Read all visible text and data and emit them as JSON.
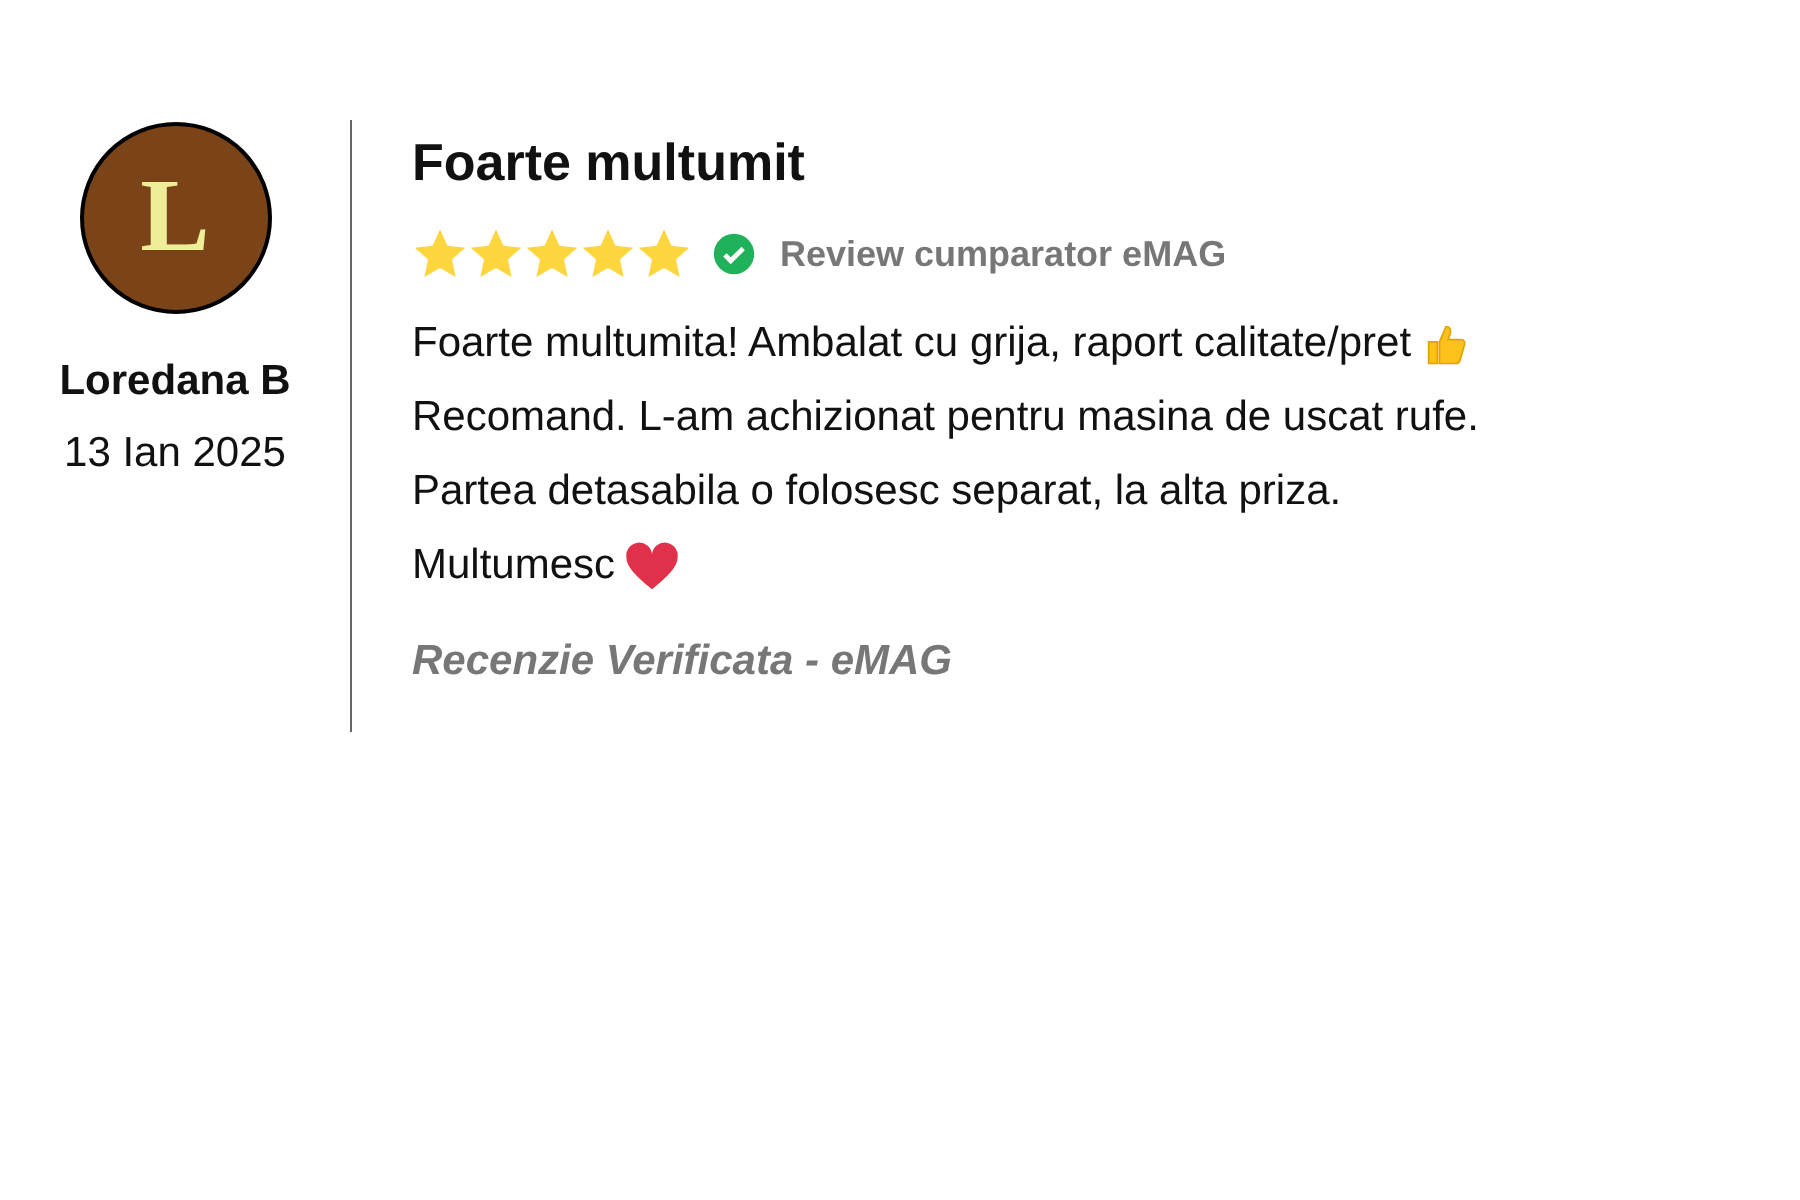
{
  "reviewer": {
    "initial": "L",
    "name": "Loredana B",
    "date": "13 Ian 2025"
  },
  "review": {
    "title": "Foarte multumit",
    "stars": 5,
    "verified": true,
    "badge": "Review cumparator eMAG",
    "lines": [
      {
        "text": "Foarte multumita! Ambalat cu grija, raport calitate/pret",
        "kind": "thumbs-up"
      },
      {
        "text": "Recomand. L-am achizionat pentru masina de uscat rufe.",
        "kind": "plain"
      },
      {
        "text": "Partea detasabila o folosesc separat, la alta priza.",
        "kind": "plain"
      },
      {
        "text": "Multumesc",
        "kind": "heart"
      }
    ],
    "footer": "Recenzie Verificata - eMAG"
  }
}
